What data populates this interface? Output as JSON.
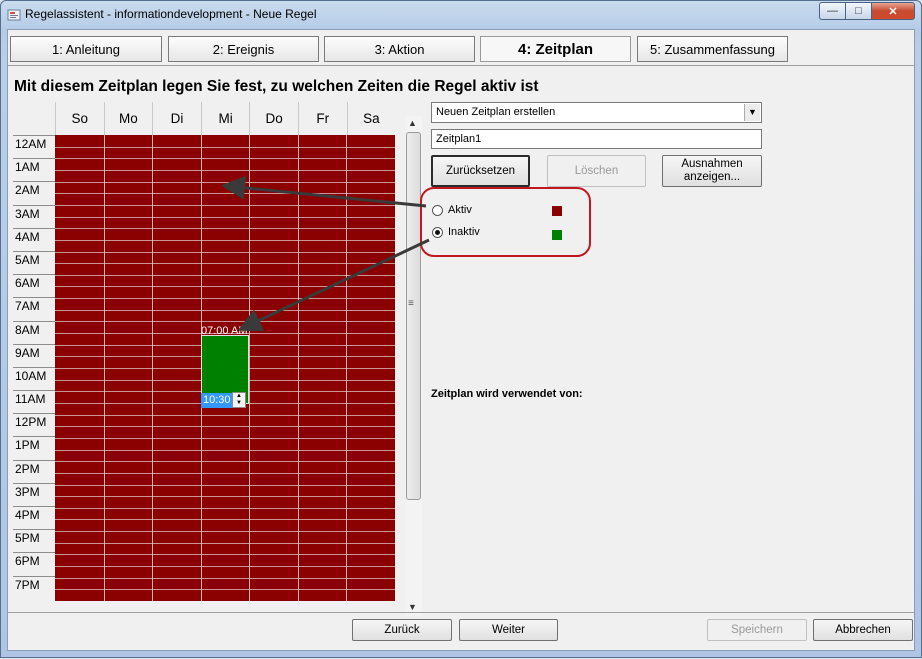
{
  "window": {
    "title": "Regelassistent - informationdevelopment - Neue Regel",
    "minimize_icon": "minimize-icon",
    "maximize_icon": "maximize-icon",
    "close_icon": "close-icon"
  },
  "tabs": [
    {
      "label": "1: Anleitung"
    },
    {
      "label": "2: Ereignis"
    },
    {
      "label": "3: Aktion"
    },
    {
      "label": "4: Zeitplan",
      "active": true
    },
    {
      "label": "5: Zusammenfassung"
    }
  ],
  "headline": "Mit diesem Zeitplan legen Sie fest, zu welchen Zeiten die Regel aktiv ist",
  "schedule": {
    "days": [
      "So",
      "Mo",
      "Di",
      "Mi",
      "Do",
      "Fr",
      "Sa"
    ],
    "hours": [
      "12AM",
      "1AM",
      "2AM",
      "3AM",
      "4AM",
      "5AM",
      "6AM",
      "7AM",
      "8AM",
      "9AM",
      "10AM",
      "11AM",
      "12PM",
      "1PM",
      "2PM",
      "3PM",
      "4PM",
      "5PM",
      "6PM",
      "7PM"
    ],
    "active_block": {
      "day": "Mi",
      "start": "07:00 AM",
      "end": "10:30"
    },
    "inactive_color": "#8b0000",
    "active_color": "#008000"
  },
  "right_panel": {
    "schedule_select": "Neuen Zeitplan erstellen",
    "schedule_name": "Zeitplan1",
    "reset_button": "Zurücksetzen",
    "delete_button": "Löschen",
    "exceptions_button": "Ausnahmen anzeigen...",
    "radio_active": "Aktiv",
    "radio_inactive": "Inaktiv",
    "selected_radio": "Inaktiv",
    "active_swatch_color": "#8b0000",
    "inactive_swatch_color": "#008000",
    "used_by_label": "Zeitplan wird verwendet von:"
  },
  "footer": {
    "back_button": "Zurück",
    "next_button": "Weiter",
    "save_button": "Speichern",
    "cancel_button": "Abbrechen"
  }
}
